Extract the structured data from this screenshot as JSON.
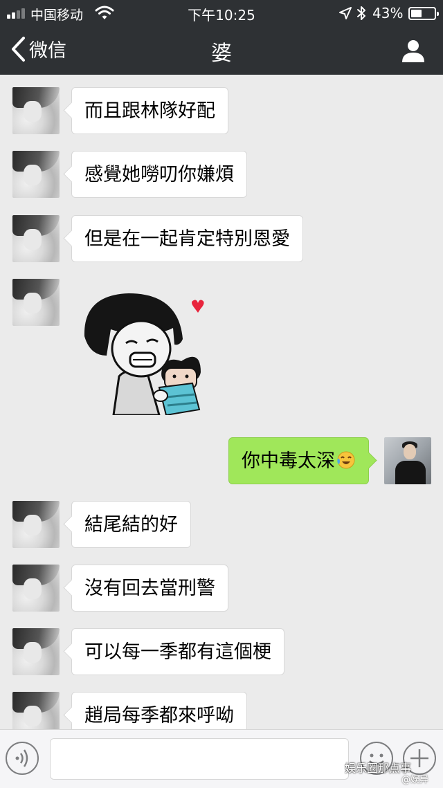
{
  "status_bar": {
    "carrier": "中国移动",
    "time": "下午10:25",
    "battery": "43%",
    "battery_level": 0.43,
    "signal_bars": 2,
    "icons": [
      "signal-icon",
      "wifi-icon",
      "location-arrow-icon",
      "bluetooth-icon",
      "battery-icon"
    ]
  },
  "nav": {
    "back_label": "微信",
    "title": "婆",
    "icons": [
      "chevron-left-icon",
      "person-icon"
    ]
  },
  "messages": [
    {
      "side": "left",
      "text": "而且跟林隊好配"
    },
    {
      "side": "left",
      "text": "感覺她嘮叨你嫌煩"
    },
    {
      "side": "left",
      "text": "但是在一起肯定特別恩愛"
    },
    {
      "side": "left",
      "type": "sticker",
      "icon": "mushroom-head-hug-sticker-icon"
    },
    {
      "side": "right",
      "text": "你中毒太深",
      "emoji": "laughing-crying-emoji-icon"
    },
    {
      "side": "left",
      "text": "結尾結的好"
    },
    {
      "side": "left",
      "text": "沒有回去當刑警"
    },
    {
      "side": "left",
      "text": "可以每一季都有這個梗"
    },
    {
      "side": "left",
      "text": "趙局每季都來呼呦"
    }
  ],
  "input_bar": {
    "placeholder": "",
    "icons": [
      "voice-icon",
      "emoji-face-icon",
      "plus-icon"
    ]
  },
  "watermark": {
    "text": "娱乐圈那点事",
    "sub": "@娱异"
  },
  "colors": {
    "header_bg": "#2e3134",
    "chat_bg": "#ebebeb",
    "sent_bubble": "#a0e75a",
    "received_bubble": "#ffffff"
  }
}
